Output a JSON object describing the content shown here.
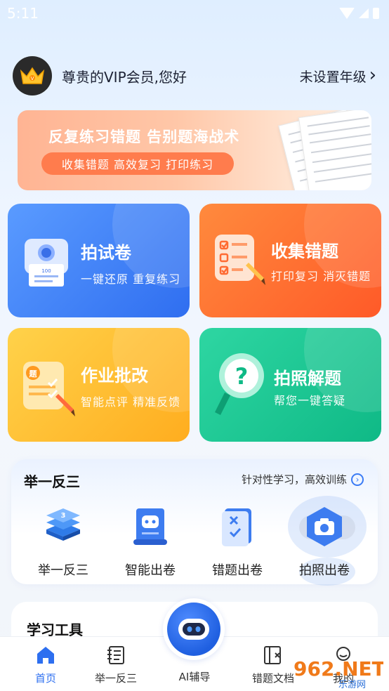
{
  "status": {
    "time": "5:11"
  },
  "header": {
    "greeting": "尊贵的VIP会员,您好",
    "grade": "未设置年级",
    "grade_chevron": "›"
  },
  "banner": {
    "title": "反复练习错题 告别题海战术",
    "pill": "收集错题 高效复习 打印练习"
  },
  "cards": [
    {
      "title": "拍试卷",
      "subtitle": "一键还原 重复练习",
      "icon": "photo-paper-icon"
    },
    {
      "title": "收集错题",
      "subtitle": "打印复习 消灭错题",
      "icon": "checklist-pencil-icon"
    },
    {
      "title": "作业批改",
      "subtitle": "智能点评 精准反馈",
      "icon": "grading-icon"
    },
    {
      "title": "拍照解题",
      "subtitle": "帮您一键答疑",
      "icon": "question-magnifier-icon"
    }
  ],
  "section1": {
    "title": "举一反三",
    "link": "针对性学习，高效训练",
    "items": [
      {
        "label": "举一反三",
        "icon": "stack-3-icon"
      },
      {
        "label": "智能出卷",
        "icon": "robot-scroll-icon"
      },
      {
        "label": "错题出卷",
        "icon": "wrong-question-paper-icon"
      },
      {
        "label": "拍照出卷",
        "icon": "camera-hex-icon"
      }
    ]
  },
  "section2": {
    "title": "学习工具"
  },
  "tabbar": {
    "items": [
      {
        "label": "首页",
        "icon": "home-icon",
        "active": true
      },
      {
        "label": "举一反三",
        "icon": "list-doc-icon",
        "active": false
      },
      {
        "label": "AI辅导",
        "icon": "ai-robot-icon",
        "active": false
      },
      {
        "label": "错题文档",
        "icon": "book-x-icon",
        "active": false
      },
      {
        "label": "我的",
        "icon": "profile-icon",
        "active": false
      }
    ]
  },
  "watermark": {
    "brand": "962.NET",
    "sub": "乐游网"
  },
  "colors": {
    "accent": "#2d6ff0",
    "orange": "#ff5a28",
    "green": "#0fb986",
    "yellow": "#ffad1f"
  }
}
